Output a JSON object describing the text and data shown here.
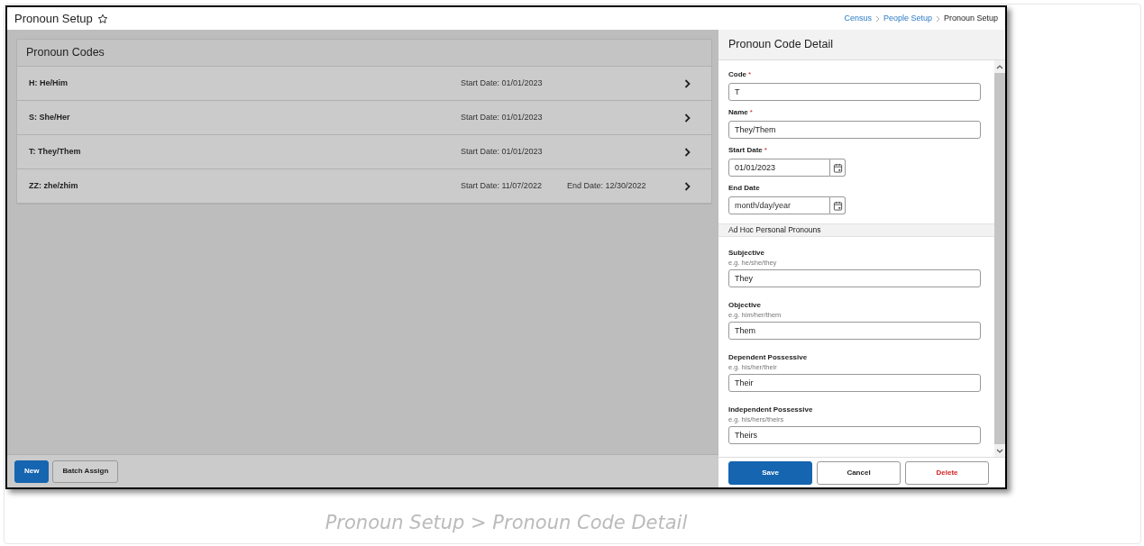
{
  "page": {
    "title": "Pronoun Setup",
    "favorite": false
  },
  "breadcrumbs": [
    {
      "label": "Census",
      "link": true
    },
    {
      "label": "People Setup",
      "link": true
    },
    {
      "label": "Pronoun Setup",
      "link": false
    }
  ],
  "list": {
    "title": "Pronoun Codes",
    "rows": [
      {
        "name": "H: He/Him",
        "start": "Start Date: 01/01/2023"
      },
      {
        "name": "S: She/Her",
        "start": "Start Date: 01/01/2023"
      },
      {
        "name": "T: They/Them",
        "start": "Start Date: 01/01/2023"
      },
      {
        "name": "ZZ: zhe/zhim",
        "start": "Start Date: 11/07/2022",
        "end": "End Date: 12/30/2022"
      }
    ]
  },
  "list_buttons": [
    {
      "label": "New",
      "primary": true
    },
    {
      "label": "Batch Assign",
      "primary": false
    }
  ],
  "detail": {
    "title": "Pronoun Code Detail",
    "fields": [
      {
        "kind": "text",
        "label": "Code",
        "required_mark": "*",
        "value": "T"
      },
      {
        "kind": "text",
        "label": "Name",
        "required_mark": "*",
        "value": "They/Them"
      },
      {
        "kind": "date",
        "label": "Start Date",
        "required_mark": "*",
        "value": "01/01/2023"
      },
      {
        "kind": "date",
        "label": "End Date",
        "placeholder": "month/day/year"
      }
    ],
    "section": "Ad Hoc Personal Pronouns",
    "pronouns": [
      {
        "label": "Subjective",
        "hint": "e.g. he/she/they",
        "value": "They"
      },
      {
        "label": "Objective",
        "hint": "e.g. him/her/them",
        "value": "Them"
      },
      {
        "label": "Dependent Possessive",
        "hint": "e.g. his/her/their",
        "value": "Their"
      },
      {
        "label": "Independent Possessive",
        "hint": "e.g. his/hers/theirs",
        "value": "Theirs"
      }
    ],
    "buttons": [
      {
        "label": "Save",
        "kind": "primary"
      },
      {
        "label": "Cancel",
        "kind": "secondary"
      },
      {
        "label": "Delete",
        "kind": "danger"
      }
    ]
  },
  "caption": "Pronoun Setup > Pronoun Code Detail"
}
